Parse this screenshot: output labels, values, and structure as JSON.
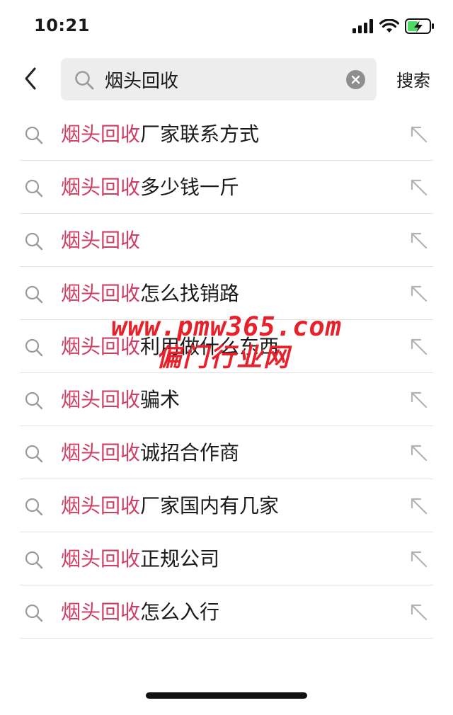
{
  "status_bar": {
    "time": "10:21",
    "icons": [
      "signal-icon",
      "wifi-icon",
      "battery-charging-icon"
    ],
    "battery_color": "#4cd964"
  },
  "search": {
    "query": "烟头回收",
    "submit_label": "搜索",
    "icons": {
      "back": "chevron-left-icon",
      "search": "search-icon",
      "clear": "clear-icon"
    }
  },
  "suggestions": [
    {
      "highlight": "烟头回收",
      "rest": "厂家联系方式"
    },
    {
      "highlight": "烟头回收",
      "rest": "多少钱一斤"
    },
    {
      "highlight": "烟头回收",
      "rest": ""
    },
    {
      "highlight": "烟头回收",
      "rest": "怎么找销路"
    },
    {
      "highlight": "烟头回收",
      "rest": "利用做什么东西"
    },
    {
      "highlight": "烟头回收",
      "rest": "骗术"
    },
    {
      "highlight": "烟头回收",
      "rest": "诚招合作商"
    },
    {
      "highlight": "烟头回收",
      "rest": "厂家国内有几家"
    },
    {
      "highlight": "烟头回收",
      "rest": "正规公司"
    },
    {
      "highlight": "烟头回收",
      "rest": "怎么入行"
    }
  ],
  "suggestion_icons": {
    "leading": "search-icon",
    "trailing": "arrow-up-left-icon"
  },
  "watermark": {
    "url": "www.pmw365.com",
    "name": "偏门行业网"
  },
  "colors": {
    "highlight": "#cf3d62",
    "watermark": "#e8202a",
    "search_box_bg": "#ededed"
  }
}
